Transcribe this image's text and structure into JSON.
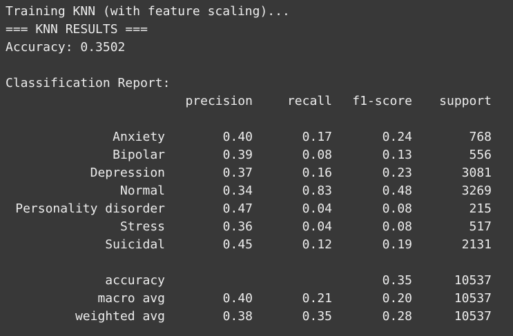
{
  "header": {
    "training_line": "Training KNN (with feature scaling)...",
    "results_line": "=== KNN RESULTS ===",
    "accuracy_line": "Accuracy: 0.3502"
  },
  "report": {
    "title": "Classification Report:",
    "columns": [
      "precision",
      "recall",
      "f1-score",
      "support"
    ],
    "rows": [
      {
        "label": "Anxiety",
        "precision": "0.40",
        "recall": "0.17",
        "f1": "0.24",
        "support": "768"
      },
      {
        "label": "Bipolar",
        "precision": "0.39",
        "recall": "0.08",
        "f1": "0.13",
        "support": "556"
      },
      {
        "label": "Depression",
        "precision": "0.37",
        "recall": "0.16",
        "f1": "0.23",
        "support": "3081"
      },
      {
        "label": "Normal",
        "precision": "0.34",
        "recall": "0.83",
        "f1": "0.48",
        "support": "3269"
      },
      {
        "label": "Personality disorder",
        "precision": "0.47",
        "recall": "0.04",
        "f1": "0.08",
        "support": "215"
      },
      {
        "label": "Stress",
        "precision": "0.36",
        "recall": "0.04",
        "f1": "0.08",
        "support": "517"
      },
      {
        "label": "Suicidal",
        "precision": "0.45",
        "recall": "0.12",
        "f1": "0.19",
        "support": "2131"
      }
    ],
    "summary": [
      {
        "label": "accuracy",
        "precision": "",
        "recall": "",
        "f1": "0.35",
        "support": "10537"
      },
      {
        "label": "macro avg",
        "precision": "0.40",
        "recall": "0.21",
        "f1": "0.20",
        "support": "10537"
      },
      {
        "label": "weighted avg",
        "precision": "0.38",
        "recall": "0.35",
        "f1": "0.28",
        "support": "10537"
      }
    ]
  }
}
